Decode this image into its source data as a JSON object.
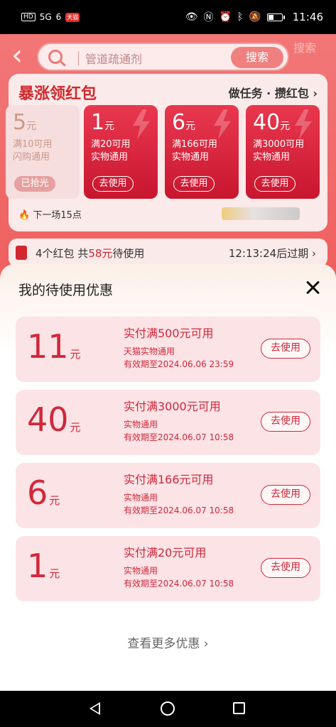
{
  "status_bar": {
    "left_badge": "HD",
    "signal": "5G",
    "wifi": "6",
    "app_badge": "天猫",
    "time": "11:46",
    "battery_level": 0.4
  },
  "background": {
    "search": {
      "query": "管道疏通剂",
      "button": "搜索",
      "ghost_button": "搜索"
    },
    "redpack": {
      "title": "暴涨领红包",
      "task_link": "做任务 · 攒红包",
      "coupons": [
        {
          "amount": "5",
          "unit": "元",
          "line1": "满10可用",
          "line2": "闪购通用",
          "button": "已抢光",
          "used": true
        },
        {
          "amount": "1",
          "unit": "元",
          "line1": "满20可用",
          "line2": "实物通用",
          "button": "去使用",
          "used": false
        },
        {
          "amount": "6",
          "unit": "元",
          "line1": "满166可用",
          "line2": "实物通用",
          "button": "去使用",
          "used": false
        },
        {
          "amount": "40",
          "unit": "元",
          "line1": "满3000可用",
          "line2": "实物通用",
          "button": "去使用",
          "used": false
        }
      ],
      "next_round": "下一场15点"
    },
    "pending": {
      "prefix": "4个红包 共",
      "amount": "58元",
      "suffix": "待使用",
      "countdown": "12:13:24",
      "countdown_suffix": "后过期"
    }
  },
  "sheet": {
    "title": "我的待使用优惠",
    "coupons": [
      {
        "amount": "11",
        "unit": "元",
        "condition": "实付满500元可用",
        "scope": "天猫实物通用",
        "expiry": "有效期至2024.06.06 23:59",
        "button": "去使用"
      },
      {
        "amount": "40",
        "unit": "元",
        "condition": "实付满3000元可用",
        "scope": "实物通用",
        "expiry": "有效期至2024.06.07 10:58",
        "button": "去使用"
      },
      {
        "amount": "6",
        "unit": "元",
        "condition": "实付满166元可用",
        "scope": "实物通用",
        "expiry": "有效期至2024.06.07 10:58",
        "button": "去使用"
      },
      {
        "amount": "1",
        "unit": "元",
        "condition": "实付满20元可用",
        "scope": "实物通用",
        "expiry": "有效期至2024.06.07 10:58",
        "button": "去使用"
      }
    ],
    "more_link": "查看更多优惠 ›"
  },
  "colors": {
    "accent": "#d0283a",
    "coupon_bg": "#fbe3e6"
  }
}
